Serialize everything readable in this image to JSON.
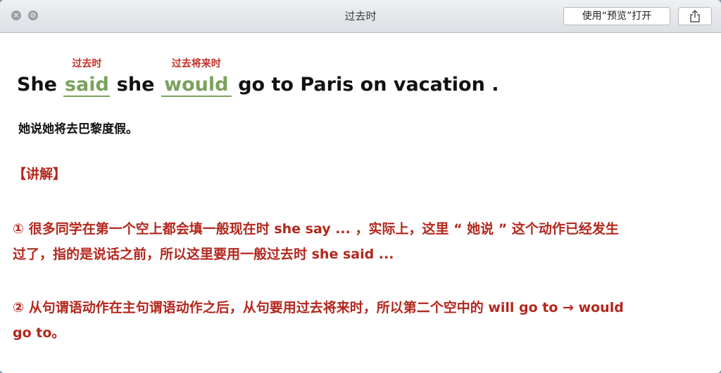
{
  "window": {
    "title": "过去时",
    "open_in_preview_label": "使用“预览”打开"
  },
  "sentence": {
    "w1": "She",
    "blank1": "said",
    "blank1_note": "过去时",
    "w2": "she",
    "blank2": "would",
    "blank2_note": "过去将来时",
    "w3": "go to Paris on vacation ."
  },
  "translation": "她说她将去巴黎度假。",
  "explanation": {
    "heading": "【讲解】",
    "point1_line1": "① 很多同学在第一个空上都会填一般现在时 she say ... ，实际上，这里 “ 她说 ” 这个动作已经发生",
    "point1_line2": "过了，指的是说话之前，所以这里要用一般过去时 she said ...",
    "point2_line1": "② 从句谓语动作在主句谓语动作之后，从句要用过去将来时，所以第二个空中的 will go to → would",
    "point2_line2": "go to。"
  }
}
